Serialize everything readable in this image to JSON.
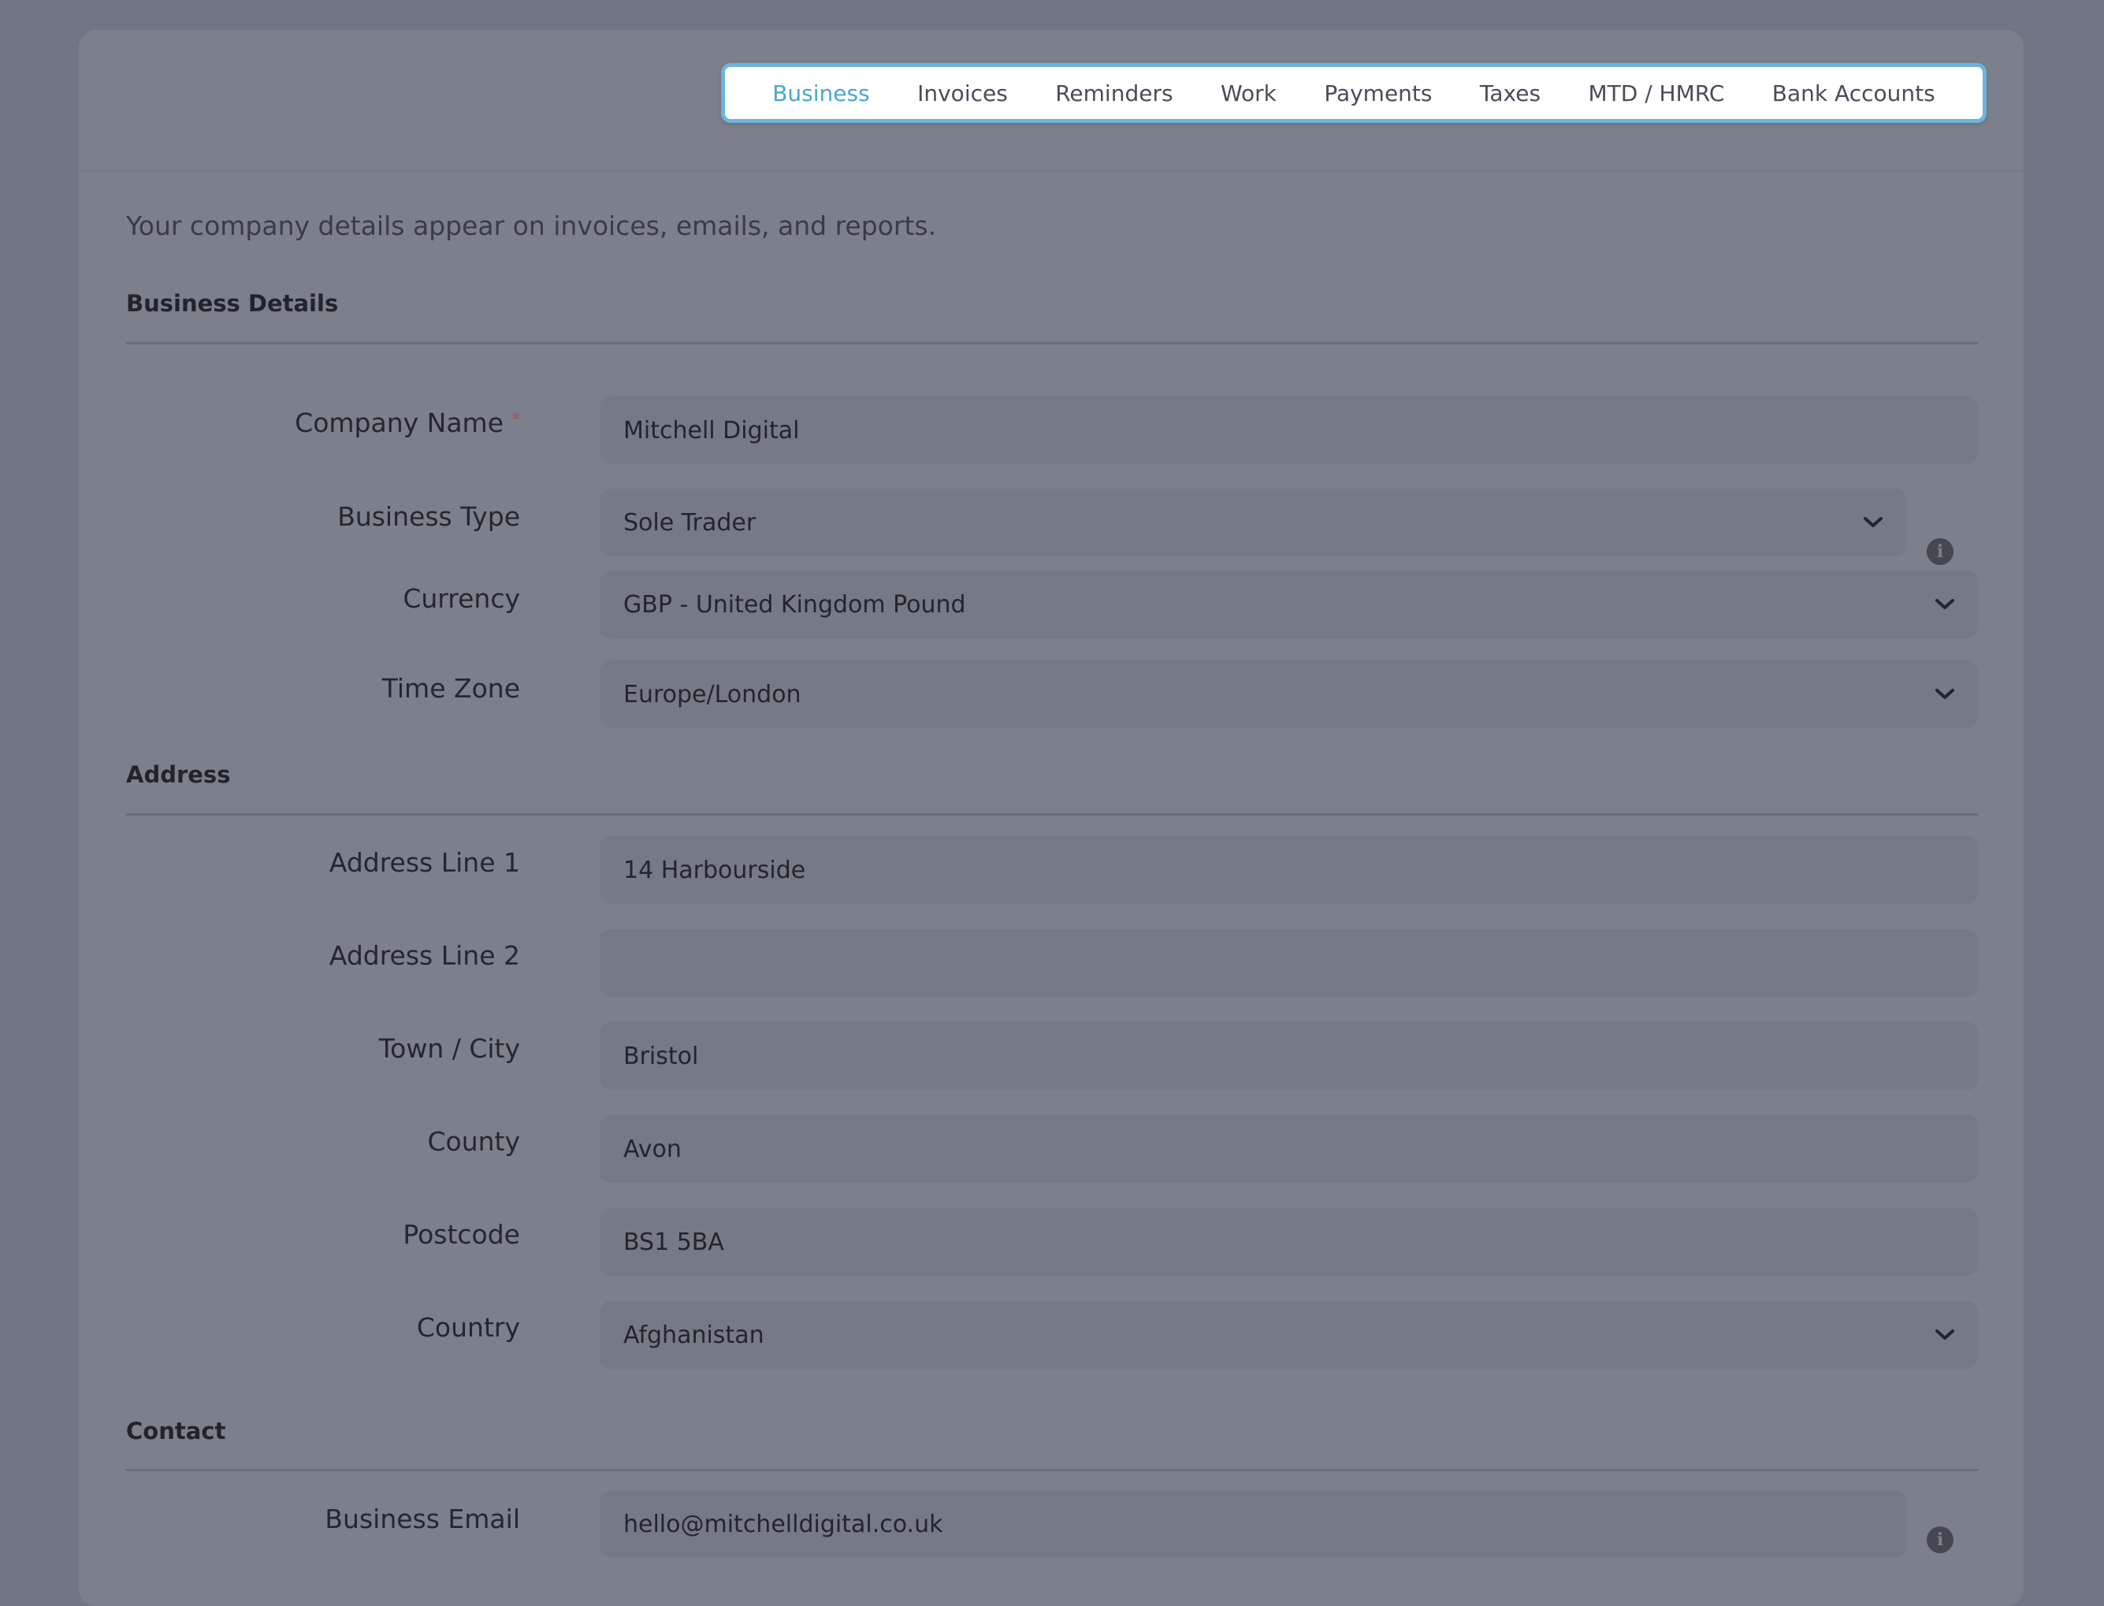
{
  "tabs": [
    "Business",
    "Invoices",
    "Reminders",
    "Work",
    "Payments",
    "Taxes",
    "MTD / HMRC",
    "Bank Accounts"
  ],
  "intro": "Your company details appear on invoices, emails, and reports.",
  "sections": {
    "business_details": "Business Details",
    "address": "Address",
    "contact": "Contact"
  },
  "fields": {
    "company_name": {
      "label": "Company Name",
      "required": "*",
      "value": "Mitchell Digital"
    },
    "business_type": {
      "label": "Business Type",
      "value": "Sole Trader"
    },
    "currency": {
      "label": "Currency",
      "value": "GBP - United Kingdom Pound"
    },
    "time_zone": {
      "label": "Time Zone",
      "value": "Europe/London"
    },
    "address_line_1": {
      "label": "Address Line 1",
      "value": "14 Harbourside"
    },
    "address_line_2": {
      "label": "Address Line 2",
      "value": ""
    },
    "town_city": {
      "label": "Town / City",
      "value": "Bristol"
    },
    "county": {
      "label": "County",
      "value": "Avon"
    },
    "postcode": {
      "label": "Postcode",
      "value": "BS1 5BA"
    },
    "country": {
      "label": "Country",
      "value": "Afghanistan"
    },
    "business_email": {
      "label": "Business Email",
      "value": "hello@mitchelldigital.co.uk"
    }
  },
  "icons": {
    "dropdown": "chevron-down-icon",
    "info": "info-icon"
  },
  "colors": {
    "active_tab": "#4aa6d2",
    "tab_border": "#6cb4dc",
    "required": "#b14d4d"
  }
}
